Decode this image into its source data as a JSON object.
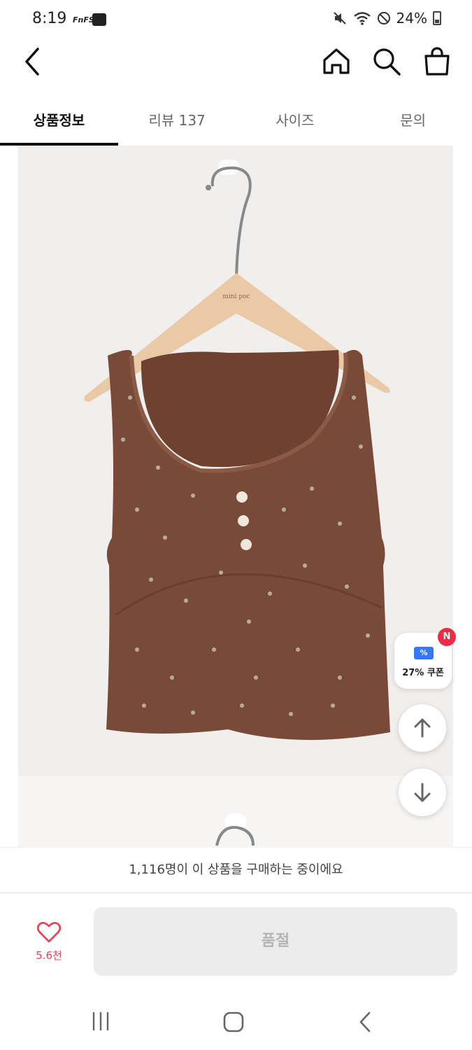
{
  "status_bar": {
    "time": "8:19",
    "app_label": "FnFS",
    "battery": "24%"
  },
  "header": {
    "back_icon": "chevron-left-icon",
    "icons": [
      "home-icon",
      "search-icon",
      "shopping-bag-icon"
    ]
  },
  "tabs": [
    {
      "label": "상품정보",
      "active": true
    },
    {
      "label": "리뷰 137",
      "active": false
    },
    {
      "label": "사이즈",
      "active": false
    },
    {
      "label": "문의",
      "active": false
    }
  ],
  "product_image": {
    "hanger_brand": "mini poc"
  },
  "floating": {
    "coupon_label": "27% 쿠폰",
    "coupon_icon_text": "%",
    "new_badge": "N"
  },
  "purchase_notice": "1,116명이 이 상품을 구매하는 중이에요",
  "bottom_bar": {
    "like_count": "5.6천",
    "soldout_label": "품절"
  },
  "colors": {
    "accent_red": "#e8445a",
    "coupon_blue": "#3478f6",
    "badge_red": "#ee2c48",
    "product_brown": "#7a4a38"
  }
}
